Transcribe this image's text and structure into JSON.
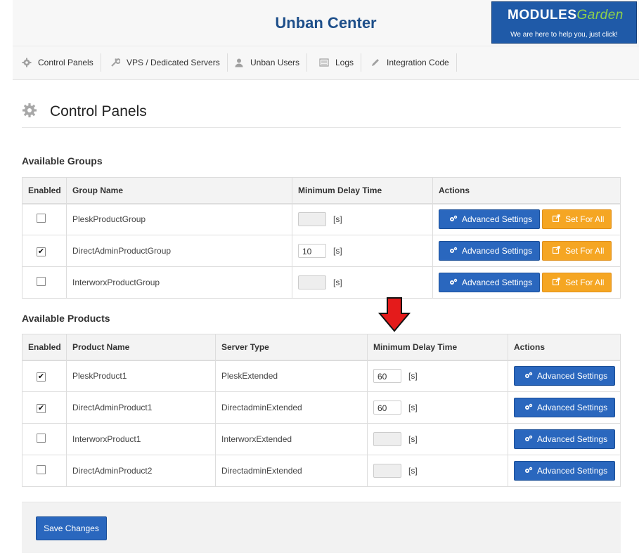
{
  "header": {
    "title": "Unban Center",
    "logo": {
      "brand_main": "MODULES",
      "brand_accent": "Garden",
      "tagline": "We are here to help you, just click!"
    }
  },
  "nav": {
    "items": [
      {
        "label": "Control Panels",
        "icon": "gear-icon"
      },
      {
        "label": "VPS / Dedicated Servers",
        "icon": "wrench-icon"
      },
      {
        "label": "Unban Users",
        "icon": "user-icon"
      },
      {
        "label": "Logs",
        "icon": "list-icon"
      },
      {
        "label": "Integration Code",
        "icon": "pencil-icon"
      }
    ]
  },
  "page": {
    "title": "Control Panels",
    "icon": "gear-icon"
  },
  "groups": {
    "title": "Available Groups",
    "columns": [
      "Enabled",
      "Group Name",
      "Minimum Delay Time",
      "Actions"
    ],
    "rows": [
      {
        "enabled": false,
        "name": "PleskProductGroup",
        "delay": "",
        "unit": "[s]"
      },
      {
        "enabled": true,
        "name": "DirectAdminProductGroup",
        "delay": "10",
        "unit": "[s]"
      },
      {
        "enabled": false,
        "name": "InterworxProductGroup",
        "delay": "",
        "unit": "[s]"
      }
    ],
    "advanced_label": "Advanced Settings",
    "setall_label": "Set For All"
  },
  "products": {
    "title": "Available Products",
    "columns": [
      "Enabled",
      "Product Name",
      "Server Type",
      "Minimum Delay Time",
      "Actions"
    ],
    "rows": [
      {
        "enabled": true,
        "name": "PleskProduct1",
        "server_type": "PleskExtended",
        "delay": "60",
        "unit": "[s]"
      },
      {
        "enabled": true,
        "name": "DirectAdminProduct1",
        "server_type": "DirectadminExtended",
        "delay": "60",
        "unit": "[s]"
      },
      {
        "enabled": false,
        "name": "InterworxProduct1",
        "server_type": "InterworxExtended",
        "delay": "",
        "unit": "[s]"
      },
      {
        "enabled": false,
        "name": "DirectAdminProduct2",
        "server_type": "DirectadminExtended",
        "delay": "",
        "unit": "[s]"
      }
    ],
    "advanced_label": "Advanced Settings"
  },
  "footer": {
    "save_label": "Save Changes"
  },
  "colors": {
    "primary": "#2a67be",
    "accent": "#f5a623",
    "title": "#1e4f8a",
    "arrow": "#e41b1b",
    "logo_green": "#8fd24a"
  },
  "checkmark": "✔"
}
